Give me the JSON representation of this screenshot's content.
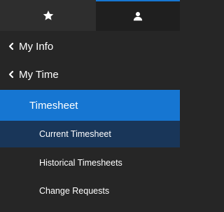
{
  "tabs": {
    "favorites_icon": "star-icon",
    "profile_icon": "user-icon",
    "active_color": "#1676d2"
  },
  "menu": {
    "my_info": "My Info",
    "my_time": "My Time",
    "timesheet": "Timesheet",
    "current_timesheet": "Current Timesheet",
    "historical_timesheets": "Historical Timesheets",
    "change_requests": "Change Requests"
  },
  "colors": {
    "background": "#262626",
    "selected_parent": "#1676d2",
    "selected_child": "#193659",
    "text": "#ffffff"
  }
}
